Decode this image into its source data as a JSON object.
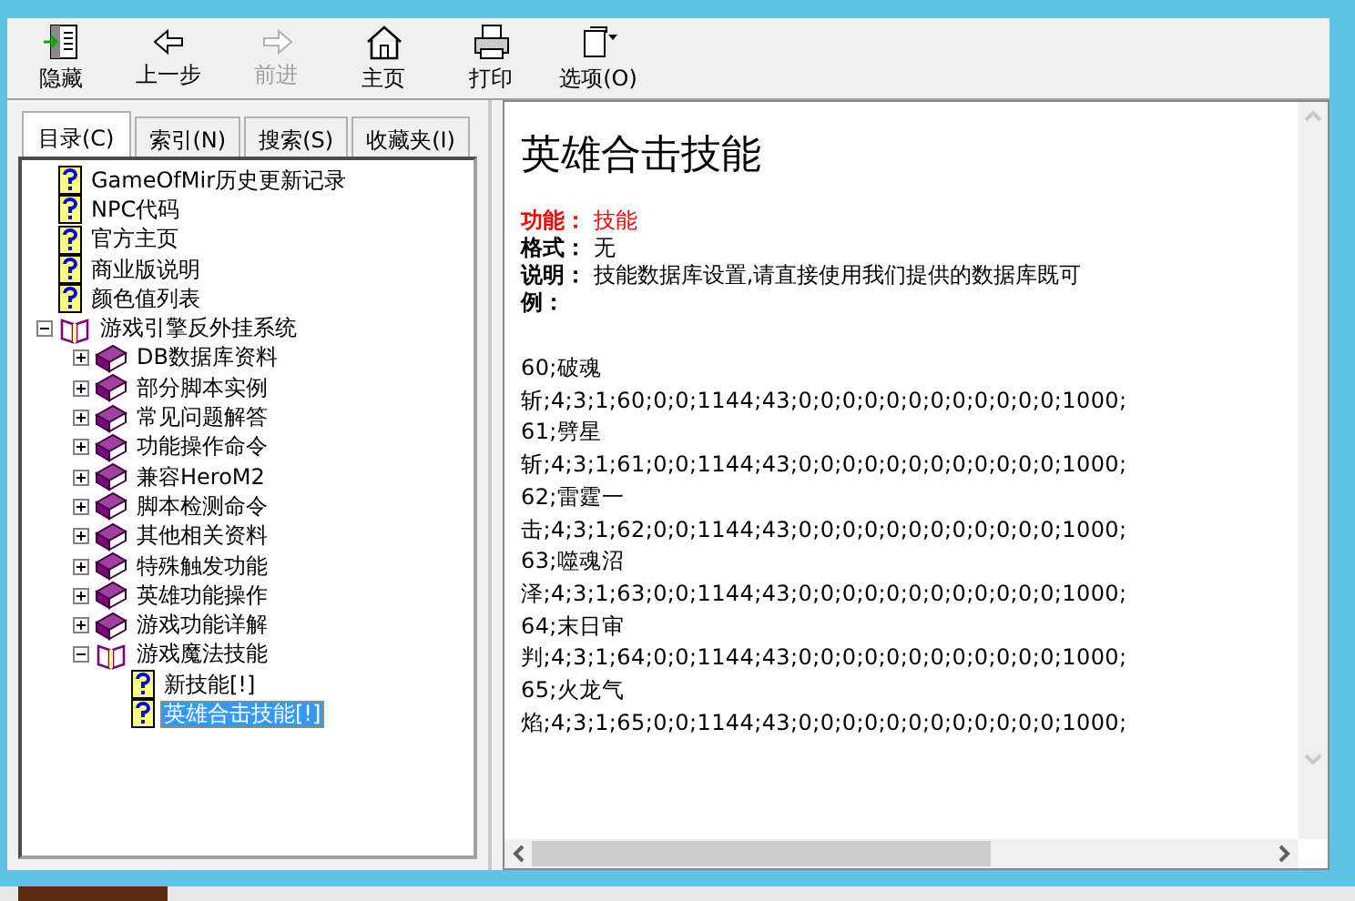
{
  "toolbar": [
    {
      "label": "隐藏",
      "kind": "hide",
      "disabled": false
    },
    {
      "label": "上一步",
      "kind": "back",
      "disabled": false
    },
    {
      "label": "前进",
      "kind": "forward",
      "disabled": true
    },
    {
      "label": "主页",
      "kind": "home",
      "disabled": false
    },
    {
      "label": "打印",
      "kind": "print",
      "disabled": false
    },
    {
      "label": "选项(O)",
      "kind": "options",
      "disabled": false
    }
  ],
  "tabs": [
    {
      "label": "目录(C)",
      "selected": true
    },
    {
      "label": "索引(N)",
      "selected": false
    },
    {
      "label": "搜索(S)",
      "selected": false
    },
    {
      "label": "收藏夹(I)",
      "selected": false
    }
  ],
  "tree": [
    {
      "label": "GameOfMir历史更新记录",
      "kind": "page",
      "selected": false
    },
    {
      "label": "NPC代码",
      "kind": "page",
      "selected": false
    },
    {
      "label": "官方主页",
      "kind": "page",
      "selected": false
    },
    {
      "label": "商业版说明",
      "kind": "page",
      "selected": false
    },
    {
      "label": "颜色值列表",
      "kind": "page",
      "selected": false
    },
    {
      "label": "游戏引擎反外挂系统",
      "kind": "book",
      "expanded": true,
      "children": [
        {
          "label": "DB数据库资料",
          "kind": "book",
          "expanded": false
        },
        {
          "label": "部分脚本实例",
          "kind": "book",
          "expanded": false
        },
        {
          "label": "常见问题解答",
          "kind": "book",
          "expanded": false
        },
        {
          "label": "功能操作命令",
          "kind": "book",
          "expanded": false
        },
        {
          "label": "兼容HeroM2",
          "kind": "book",
          "expanded": false
        },
        {
          "label": "脚本检测命令",
          "kind": "book",
          "expanded": false
        },
        {
          "label": "其他相关资料",
          "kind": "book",
          "expanded": false
        },
        {
          "label": "特殊触发功能",
          "kind": "book",
          "expanded": false
        },
        {
          "label": "英雄功能操作",
          "kind": "book",
          "expanded": false
        },
        {
          "label": "游戏功能详解",
          "kind": "book",
          "expanded": false
        },
        {
          "label": "游戏魔法技能",
          "kind": "book",
          "expanded": true,
          "children": [
            {
              "label": "新技能[!]",
              "kind": "page",
              "selected": false
            },
            {
              "label": "英雄合击技能[!]",
              "kind": "page",
              "selected": true
            }
          ]
        }
      ]
    }
  ],
  "content": {
    "title": "英雄合击技能",
    "fields": [
      {
        "label": "功能：",
        "value": "技能",
        "kind": "highlight"
      },
      {
        "label": "格式：",
        "value": "无",
        "kind": "normal"
      },
      {
        "label": "说明：",
        "value": "技能数据库设置,请直接使用我们提供的数据库既可",
        "kind": "normal"
      },
      {
        "label": "例：",
        "kind": "normal"
      }
    ],
    "code_lines": [
      "60;破魂",
      "斩;4;3;1;60;0;0;1144;43;0;0;0;0;0;0;0;0;0;0;0;0;1000;",
      "61;劈星",
      "斩;4;3;1;61;0;0;1144;43;0;0;0;0;0;0;0;0;0;0;0;0;1000;",
      "62;雷霆一",
      "击;4;3;1;62;0;0;1144;43;0;0;0;0;0;0;0;0;0;0;0;0;1000;",
      "63;噬魂沼",
      "泽;4;3;1;63;0;0;1144;43;0;0;0;0;0;0;0;0;0;0;0;0;1000;",
      "64;末日审",
      "判;4;3;1;64;0;0;1144;43;0;0;0;0;0;0;0;0;0;0;0;0;1000;",
      "65;火龙气",
      "焰;4;3;1;65;0;0;1144;43;0;0;0;0;0;0;0;0;0;0;0;0;1000;"
    ]
  }
}
